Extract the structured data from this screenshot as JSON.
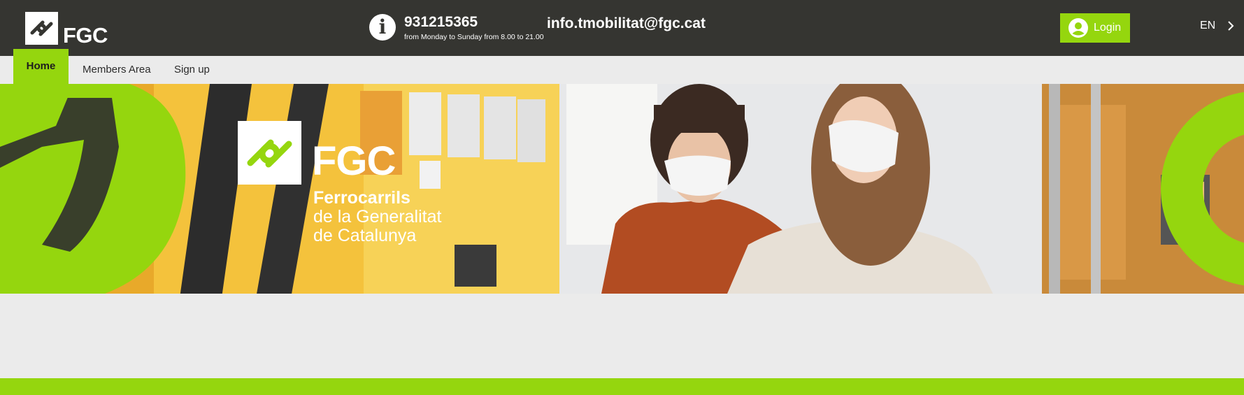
{
  "header": {
    "logo_text": "FGC",
    "info_icon": "info-icon",
    "phone": "931215365",
    "hours": "from Monday to Sunday from 8.00 to 21.00",
    "email": "info.tmobilitat@fgc.cat",
    "login_label": "Login",
    "login_icon": "user-icon",
    "language": "EN",
    "language_icon": "chevron-right-icon"
  },
  "nav": {
    "tabs": [
      {
        "label": "Home",
        "active": true
      },
      {
        "label": "Members Area",
        "active": false
      },
      {
        "label": "Sign up",
        "active": false
      }
    ]
  },
  "hero": {
    "brand": "FGC",
    "line1": "Ferrocarrils",
    "line2": "de la Generalitat",
    "line3": "de Catalunya"
  },
  "colors": {
    "header_bg": "#353531",
    "accent_green": "#95d60e",
    "page_bg": "#ebebeb"
  }
}
